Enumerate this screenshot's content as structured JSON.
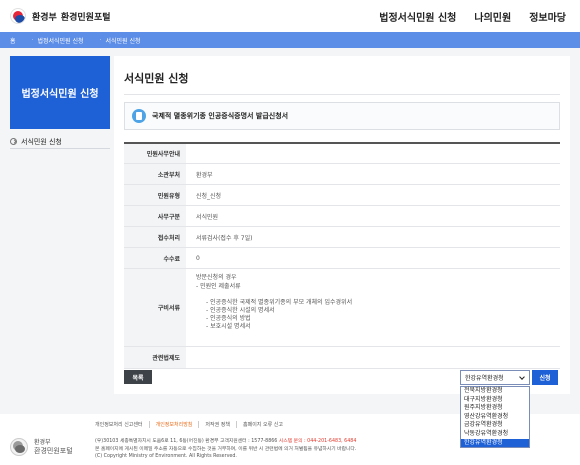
{
  "header": {
    "logo_org": "환경부",
    "logo_site": "환경민원포털",
    "nav": [
      "법정서식민원 신청",
      "나의민원",
      "정보마당"
    ]
  },
  "location": {
    "home": "홈",
    "crumbs": [
      "법정서식민원 신청",
      "서식민원 신청"
    ]
  },
  "sidebar": {
    "title": "법정서식민원 신청",
    "items": [
      {
        "label": "서식민원 신청"
      }
    ]
  },
  "main": {
    "title": "서식민원 신청",
    "form_title": "국제적 멸종위기종 인공증식증명서 발급신청서"
  },
  "table": {
    "rows": [
      {
        "label": "민원사무안내",
        "value": ""
      },
      {
        "label": "소관부처",
        "value": "환경부"
      },
      {
        "label": "민원유형",
        "value": "신청_신청"
      },
      {
        "label": "사무구분",
        "value": "서식민원"
      },
      {
        "label": "접수처리",
        "value": "서류검사(접수 후 7일)"
      },
      {
        "label": "수수료",
        "value": "0"
      }
    ],
    "docs": {
      "label": "구비서류",
      "lines": [
        "방문신청의 경우",
        "- 민원인 제출서류"
      ],
      "sublines": [
        "- 인공증식한 국제적 멸종위기종의 부모 개체의 입수경위서",
        "- 인공증식한 시설의 명세서",
        "- 인공증식의 방법",
        "- 보호시설 명세서"
      ]
    },
    "law": {
      "label": "관련법제도",
      "value": ""
    }
  },
  "controls": {
    "list_button": "목록",
    "select_value": "한강유역환경청",
    "apply_button": "신청",
    "options": [
      "전북지방환경청",
      "대구지방환경청",
      "원주지방환경청",
      "영산강유역환경청",
      "금강유역환경청",
      "낙동강유역환경청",
      "한강유역환경청"
    ]
  },
  "footer": {
    "links": [
      "개인정보처리 신고센터",
      "개인정보처리방침",
      "저작권 정책",
      "홈페이지 오류 신고"
    ],
    "logo_org": "환경부",
    "logo_site": "환경민원포털",
    "address": "(우)30103 세종특별자치시 도움6로 11, 6동(어진동) 환경부  고객지원센터 : 1577-8866",
    "system_inquiry": "시스템 문의 : 044-201-6483, 6484",
    "notice": "본 홈페이지에 게시된 이메일 주소를 자동으로 수집하는 것을 거부하며, 이를 위반 시 관련법에 의거 처벌됨을 유념하시기 바랍니다.",
    "copyright": "(C) Copyright Ministry of Environment. All Rights Reserved."
  },
  "colors": {
    "accent": "#1e60d6",
    "locbar": "#5d8ee7"
  }
}
